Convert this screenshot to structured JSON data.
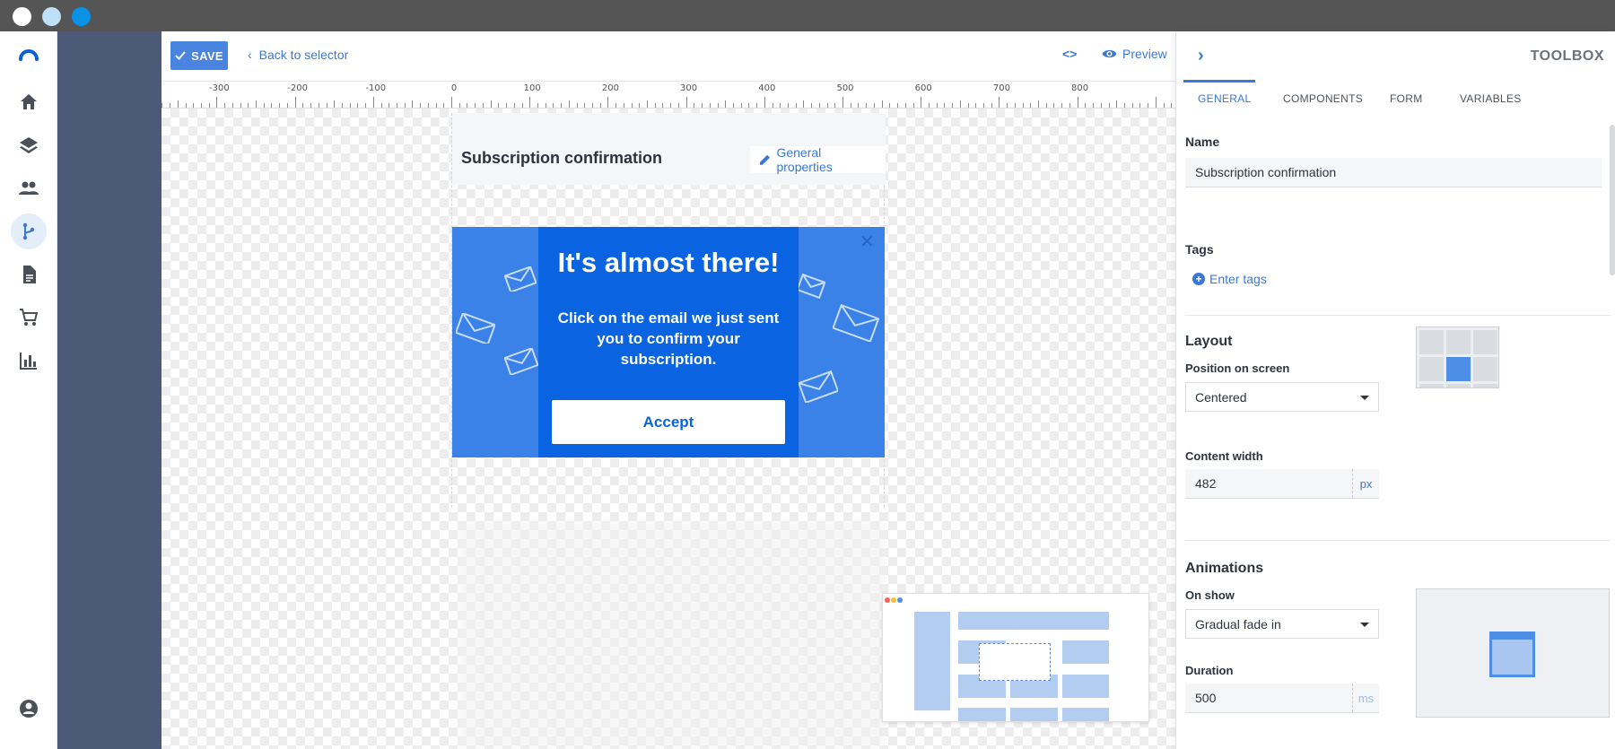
{
  "window": {
    "dots": [
      "#ffffff",
      "#bfe1f7",
      "#0a92e6"
    ]
  },
  "nav": {
    "items": [
      {
        "name": "home",
        "icon": "home-icon"
      },
      {
        "name": "layers",
        "icon": "layers-icon"
      },
      {
        "name": "contacts",
        "icon": "people-icon"
      },
      {
        "name": "flows",
        "icon": "branch-icon",
        "active": true
      },
      {
        "name": "documents",
        "icon": "document-icon"
      },
      {
        "name": "ecommerce",
        "icon": "cart-icon"
      },
      {
        "name": "reports",
        "icon": "bar-chart-icon"
      }
    ],
    "bottom_icon": "account-icon"
  },
  "toolbar": {
    "save_label": "SAVE",
    "back_label": "Back to selector",
    "code_label": "<>",
    "preview_label": "Preview"
  },
  "ruler": {
    "labels": [
      "-300",
      "-200",
      "-100",
      "0",
      "100",
      "200",
      "300",
      "400",
      "500",
      "600",
      "700",
      "800"
    ]
  },
  "canvas": {
    "title": "Subscription confirmation",
    "general_properties_label": "General properties",
    "popup": {
      "headline": "It's almost there!",
      "body": "Click on the email we just sent you to confirm your subscription.",
      "button_label": "Accept",
      "close_glyph": "✕",
      "colors": {
        "outer": "#3b82e8",
        "inner": "#0a63e0"
      }
    }
  },
  "toolbox": {
    "title": "TOOLBOX",
    "tabs": [
      {
        "label": "GENERAL",
        "active": true
      },
      {
        "label": "COMPONENTS"
      },
      {
        "label": "FORM"
      },
      {
        "label": "VARIABLES"
      }
    ],
    "name_label": "Name",
    "name_value": "Subscription confirmation",
    "tags_label": "Tags",
    "enter_tags_label": "Enter tags",
    "layout_title": "Layout",
    "position_label": "Position on screen",
    "position_value": "Centered",
    "content_width_label": "Content width",
    "content_width_value": "482",
    "content_width_unit": "px",
    "animations_title": "Animations",
    "on_show_label": "On show",
    "on_show_value": "Gradual fade in",
    "duration_label": "Duration",
    "duration_value": "500",
    "duration_unit": "ms"
  }
}
